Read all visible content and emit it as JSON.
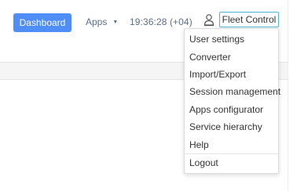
{
  "header": {
    "dashboard_label": "Dashboard",
    "apps_label": "Apps",
    "clock": "19:36:28 (+04)",
    "fleet_label": "Fleet Control"
  },
  "user_menu": {
    "items": [
      "User settings",
      "Converter",
      "Import/Export",
      "Session management",
      "Apps configurator",
      "Service hierarchy",
      "Help"
    ],
    "logout_label": "Logout"
  },
  "colors": {
    "accent": "#4f8ef7",
    "fleet_border": "#4fb3cf",
    "nav_text": "#5b6f8a"
  },
  "icons": {
    "user": "user-icon",
    "apps_caret": "caret-down-icon"
  }
}
